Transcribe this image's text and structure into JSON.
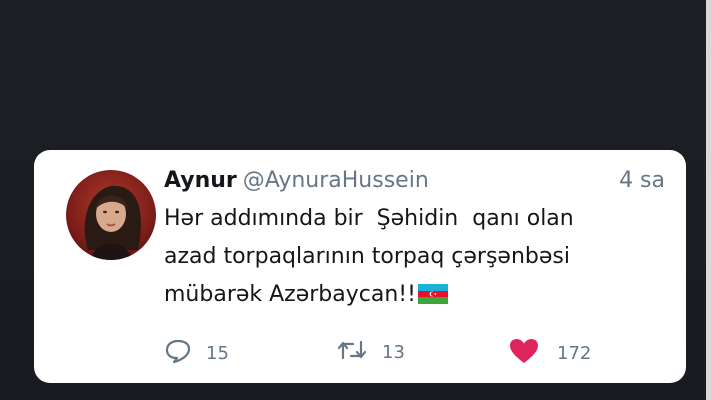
{
  "tweet": {
    "author_name": "Aynur",
    "author_handle": "@AynuraHussein",
    "time": "4 sa",
    "text_lines": [
      "Hər addımında bir  Şəhidin  qanı olan",
      "azad torpaqlarının torpaq çərşənbəsi",
      "mübarək Azərbaycan!!"
    ],
    "emoji": "flag-azerbaijan",
    "replies": "15",
    "retweets": "13",
    "likes": "172",
    "like_color": "#e0245e"
  },
  "icons": {
    "reply": "reply-icon",
    "retweet": "retweet-icon",
    "like": "heart-icon"
  }
}
